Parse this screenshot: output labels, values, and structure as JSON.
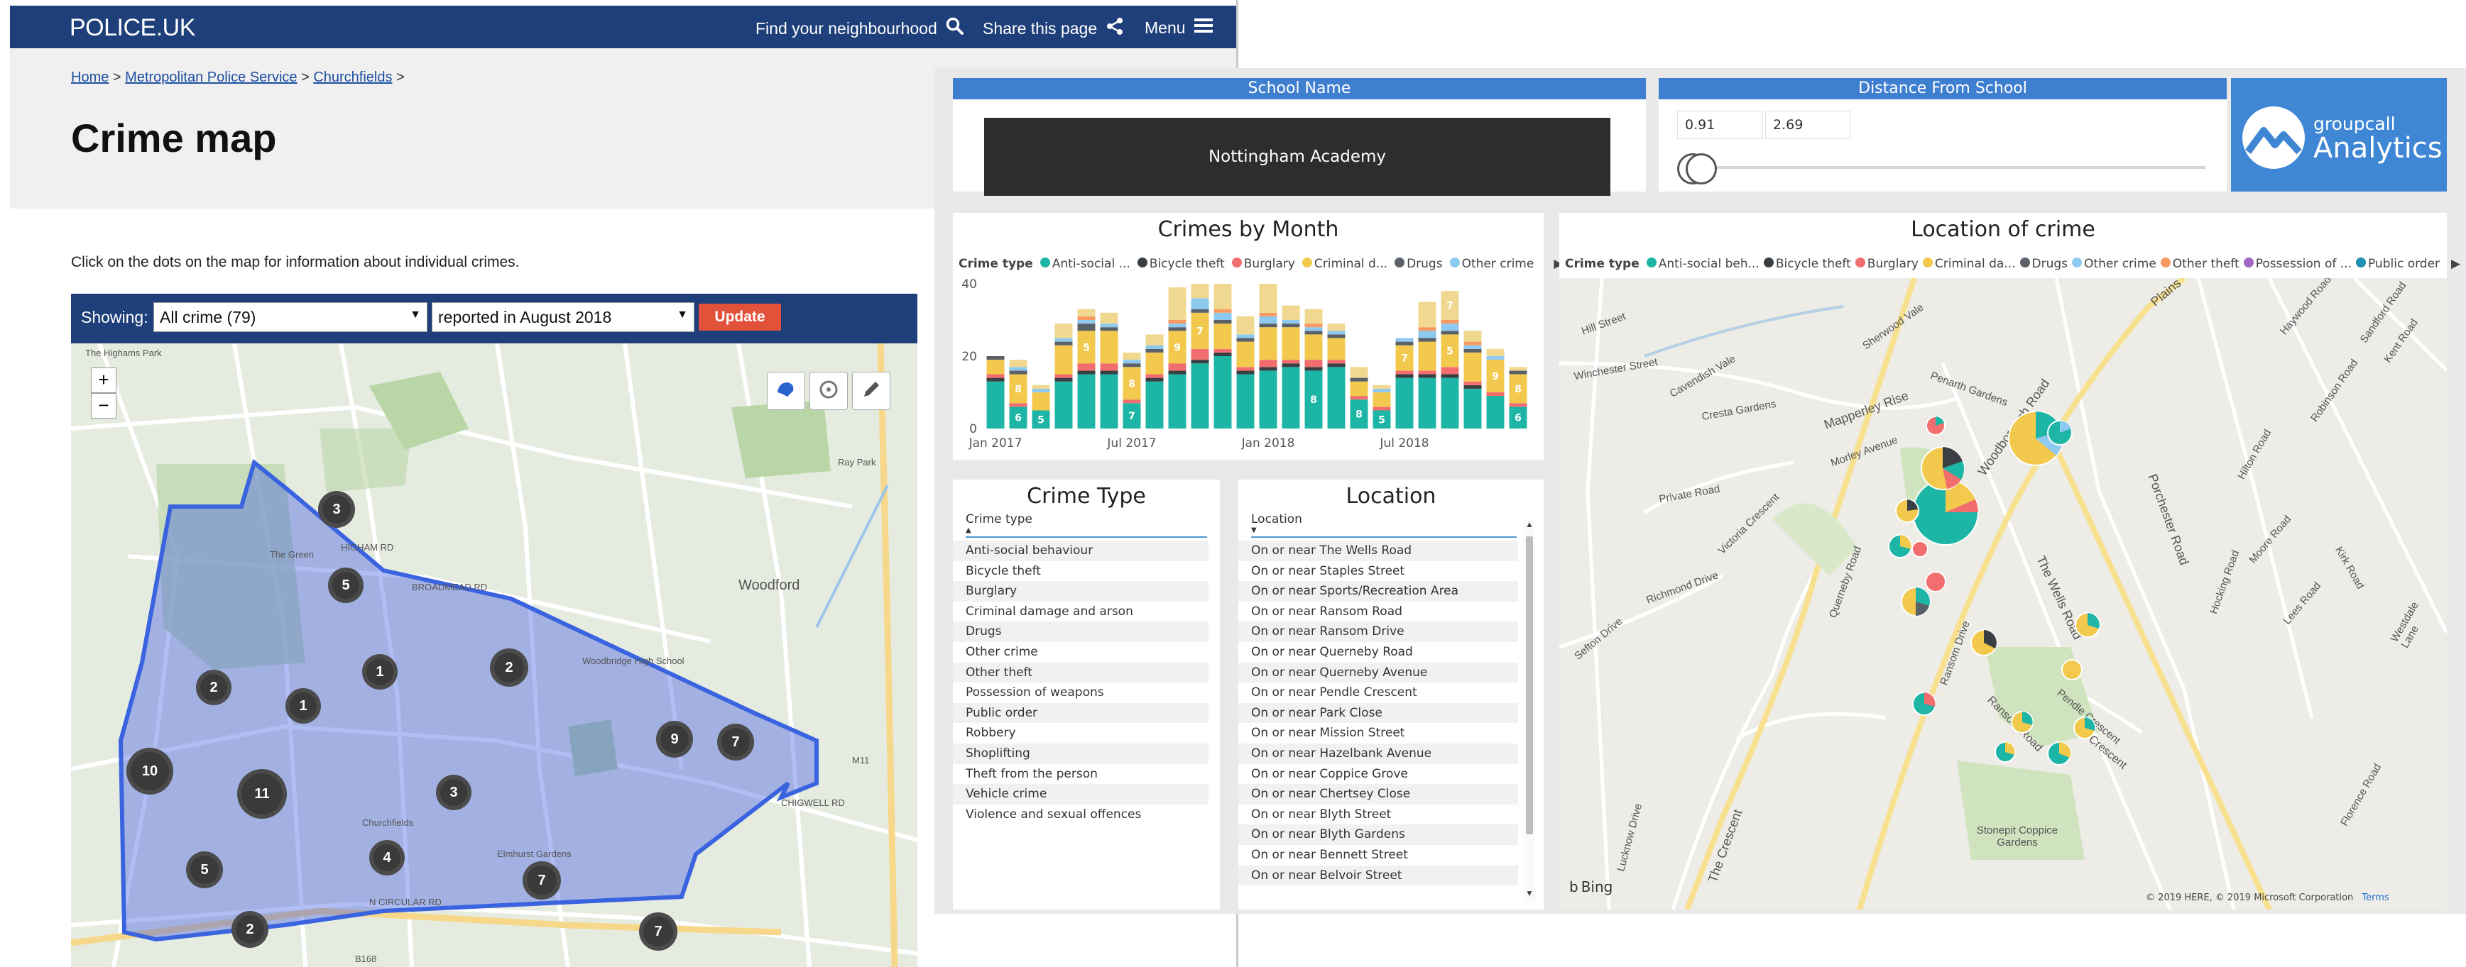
{
  "police": {
    "logo": "POLICE.UK",
    "nav": {
      "find_neighbourhood": "Find your neighbourhood",
      "share": "Share this page",
      "menu": "Menu"
    },
    "breadcrumb": [
      {
        "label": "Home"
      },
      {
        "label": "Metropolitan Police Service"
      },
      {
        "label": "Churchfields"
      }
    ],
    "breadcrumb_sep": ">",
    "title": "Crime map",
    "intro": "Click on the dots on the map for information about individual crimes.",
    "filter": {
      "showing_label": "Showing:",
      "crime_select": "All crime (79)",
      "period_select": "reported in August 2018",
      "update_button": "Update"
    },
    "map": {
      "zoom_in": "+",
      "zoom_out": "−",
      "tools": [
        "draw-area-icon",
        "locate-icon",
        "pencil-icon"
      ],
      "clusters": [
        3,
        5,
        2,
        1,
        1,
        2,
        10,
        11,
        3,
        9,
        7,
        4,
        7,
        5,
        2,
        7
      ],
      "place_labels": [
        "The Highams Park",
        "Ray Park",
        "Woodford",
        "The Green",
        "Woodbridge High School",
        "Churchfields",
        "Elmhurst Gardens",
        "N CIRCULAR RD",
        "BROADMEAD RD",
        "HIGHAM RD",
        "B168",
        "M11",
        "CHIGWELL RD"
      ]
    }
  },
  "dashboard": {
    "school_slicer": {
      "header": "School Name",
      "value": "Nottingham Academy"
    },
    "distance_slicer": {
      "header": "Distance From School",
      "min": "0.91",
      "max": "2.69"
    },
    "brand": {
      "line1": "groupcall",
      "line2": "Analytics"
    },
    "crimes_by_month": {
      "title": "Crimes by Month",
      "legend_title": "Crime type"
    },
    "location_of_crime": {
      "title": "Location of crime",
      "legend_title": "Crime type",
      "legend": [
        "Anti-social beh...",
        "Bicycle theft",
        "Burglary",
        "Criminal da...",
        "Drugs",
        "Other crime",
        "Other theft",
        "Possession of ...",
        "Public order"
      ],
      "bing": "Bing",
      "copyright": "© 2019 HERE, © 2019 Microsoft Corporation",
      "terms": "Terms",
      "streets": [
        "Hill Street",
        "Winchester Street",
        "Cavendish Vale",
        "Sherwood Vale",
        "Cresta Gardens",
        "Mapperley Rise",
        "Morley Avenue",
        "Penarth Gardens",
        "Private Road",
        "Victoria Crescent",
        "Richmond Drive",
        "Sefton Drive",
        "Querneby Road",
        "Woodborough Road",
        "The Wells Road",
        "Porchester Road",
        "Hilton Road",
        "Robinson Road",
        "Moore Road",
        "Hocking Road",
        "Kirk Road",
        "Lees Road",
        "Ransom Road",
        "Crescent",
        "Stonepit Coppice Gardens",
        "The Crescent",
        "Lucknow Drive",
        "Plains",
        "Westdale Lane",
        "Florence Road",
        "Kent Road",
        "Sandford Road",
        "Haywood Road",
        "Pendle Crescent",
        "Ransom Drive"
      ]
    },
    "crime_type_slicer": {
      "title": "Crime Type",
      "header": "Crime type",
      "items": [
        "Anti-social behaviour",
        "Bicycle theft",
        "Burglary",
        "Criminal damage and arson",
        "Drugs",
        "Other crime",
        "Other theft",
        "Possession of weapons",
        "Public order",
        "Robbery",
        "Shoplifting",
        "Theft from the person",
        "Vehicle crime",
        "Violence and sexual offences"
      ]
    },
    "location_slicer": {
      "title": "Location",
      "header": "Location",
      "items": [
        "On or near The Wells Road",
        "On or near Staples Street",
        "On or near Sports/Recreation Area",
        "On or near Ransom Road",
        "On or near Ransom Drive",
        "On or near Querneby Road",
        "On or near Querneby Avenue",
        "On or near Pendle Crescent",
        "On or near Park Close",
        "On or near Mission Street",
        "On or near Hazelbank Avenue",
        "On or near Coppice Grove",
        "On or near Chertsey Close",
        "On or near Blyth Street",
        "On or near Blyth Gardens",
        "On or near Bennett Street",
        "On or near Belvoir Street"
      ]
    }
  },
  "chart_data": {
    "type": "bar",
    "stacked": true,
    "title": "Crimes by Month",
    "legend_title": "Crime type",
    "x_axis_ticks": [
      "Jan 2017",
      "Jul 2017",
      "Jan 2018",
      "Jul 2018"
    ],
    "y_ticks": [
      0,
      20,
      40
    ],
    "ylim": [
      0,
      40
    ],
    "categories": [
      "Jan 2017",
      "Feb 2017",
      "Mar 2017",
      "Apr 2017",
      "May 2017",
      "Jun 2017",
      "Jul 2017",
      "Aug 2017",
      "Sep 2017",
      "Oct 2017",
      "Nov 2017",
      "Dec 2017",
      "Jan 2018",
      "Feb 2018",
      "Mar 2018",
      "Apr 2018",
      "May 2018",
      "Jun 2018",
      "Jul 2018",
      "Aug 2018",
      "Sep 2018",
      "Oct 2018",
      "Nov 2018",
      "Dec 2018"
    ],
    "series": [
      {
        "name": "Anti-social ...",
        "color": "#1cb5a6",
        "values": [
          13,
          6,
          5,
          13,
          15,
          15,
          7,
          13,
          15,
          18,
          20,
          15,
          16,
          17,
          16,
          17,
          8,
          5,
          14,
          14,
          14,
          11,
          9,
          6
        ]
      },
      {
        "name": "Bicycle theft",
        "color": "#3a3f44",
        "values": [
          1,
          0,
          0,
          1,
          1,
          1,
          0,
          1,
          1,
          1,
          1,
          1,
          1,
          1,
          1,
          1,
          0,
          0,
          1,
          1,
          1,
          1,
          0,
          0
        ]
      },
      {
        "name": "Burglary",
        "color": "#f26e6e",
        "values": [
          1,
          1,
          0,
          1,
          2,
          2,
          1,
          1,
          2,
          3,
          1,
          1,
          2,
          1,
          2,
          1,
          1,
          1,
          1,
          1,
          2,
          1,
          1,
          1
        ]
      },
      {
        "name": "Criminal d...",
        "color": "#f2c94c",
        "values": [
          4,
          8,
          5,
          8,
          9,
          9,
          9,
          6,
          9,
          10,
          7,
          7,
          9,
          9,
          7,
          6,
          4,
          4,
          7,
          8,
          9,
          8,
          9,
          8
        ]
      },
      {
        "name": "Drugs",
        "color": "#5b6168",
        "values": [
          1,
          1,
          0,
          1,
          2,
          1,
          1,
          1,
          1,
          1,
          1,
          1,
          1,
          1,
          1,
          1,
          1,
          0,
          1,
          1,
          1,
          1,
          0,
          1
        ]
      },
      {
        "name": "Other crime",
        "color": "#8ecaf0",
        "values": [
          0,
          1,
          1,
          1,
          1,
          1,
          1,
          1,
          1,
          3,
          2,
          1,
          2,
          1,
          1,
          1,
          0,
          1,
          1,
          2,
          2,
          1,
          1,
          0
        ]
      },
      {
        "name": "Other theft",
        "color": "#f79a62",
        "values": [
          0,
          0,
          0,
          0,
          1,
          0,
          0,
          0,
          1,
          0,
          1,
          0,
          1,
          0,
          1,
          0,
          0,
          0,
          0,
          1,
          1,
          1,
          0,
          0
        ]
      },
      {
        "name": "Public order",
        "color": "#f0d890",
        "values": [
          0,
          2,
          1,
          4,
          2,
          3,
          2,
          3,
          9,
          4,
          7,
          5,
          8,
          4,
          4,
          2,
          3,
          1,
          0,
          7,
          8,
          3,
          2,
          1
        ]
      }
    ],
    "data_labels": [
      {
        "category": "Feb 2017",
        "series": "Anti-social ...",
        "text": "6"
      },
      {
        "category": "Feb 2017",
        "series": "Criminal d...",
        "text": "8"
      },
      {
        "category": "Mar 2017",
        "series": "Anti-social ...",
        "text": "5"
      },
      {
        "category": "May 2017",
        "series": "Criminal d...",
        "text": "5"
      },
      {
        "category": "Jul 2017",
        "series": "Anti-social ...",
        "text": "7"
      },
      {
        "category": "Jul 2017",
        "series": "Criminal d...",
        "text": "8"
      },
      {
        "category": "Sep 2017",
        "series": "Criminal d...",
        "text": "9"
      },
      {
        "category": "Oct 2017",
        "series": "Criminal d...",
        "text": "7"
      },
      {
        "category": "Mar 2018",
        "series": "Anti-social ...",
        "text": "8"
      },
      {
        "category": "May 2018",
        "series": "Anti-social ...",
        "text": "8"
      },
      {
        "category": "Jun 2018",
        "series": "Anti-social ...",
        "text": "5"
      },
      {
        "category": "Jul 2018",
        "series": "Criminal d...",
        "text": "7"
      },
      {
        "category": "Sep 2018",
        "series": "Public order",
        "text": "7"
      },
      {
        "category": "Sep 2018",
        "series": "Criminal d...",
        "text": "5"
      },
      {
        "category": "Nov 2018",
        "series": "Criminal d...",
        "text": "9"
      },
      {
        "category": "Dec 2018",
        "series": "Anti-social ...",
        "text": "6"
      },
      {
        "category": "Dec 2018",
        "series": "Criminal d...",
        "text": "8"
      }
    ]
  }
}
